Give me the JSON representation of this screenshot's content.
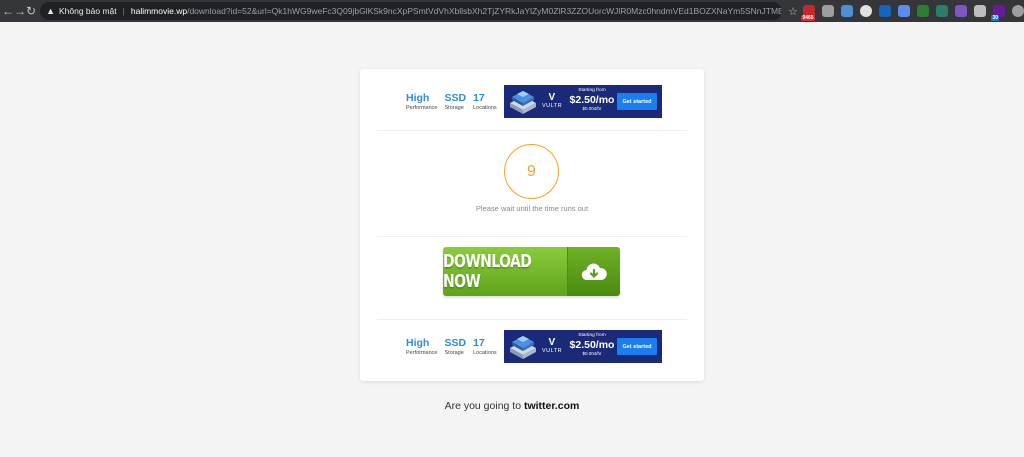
{
  "browser": {
    "security_label": "Không bảo mật",
    "url_host": "halimmovie.wp",
    "url_rest": "/download?id=52&url=Qk1hWG9weFc3Q09jbGlKSk9ncXpPSmtVdVhXbllsbXh2TjZYRkJaYlZyM0ZlR3ZZOUorcWJlR0Mzc0hndmVEd1BOZXNaYm5SNnJTMEJXSVdvdzd1Y3RBR...",
    "extension_badges": [
      "9465",
      "30"
    ]
  },
  "ads": [
    {
      "stats": [
        {
          "big": "High",
          "small": "Performance"
        },
        {
          "big": "SSD",
          "small": "Storage"
        },
        {
          "big": "17",
          "small": "Locations"
        }
      ],
      "brand": "VULTR",
      "starting_from": "Starting from",
      "price": "$2.50/mo",
      "hourly": "$0.004/hr",
      "cta": "Get started"
    },
    {
      "stats": [
        {
          "big": "High",
          "small": "Performance"
        },
        {
          "big": "SSD",
          "small": "Storage"
        },
        {
          "big": "17",
          "small": "Locations"
        }
      ],
      "brand": "VULTR",
      "starting_from": "Starting from",
      "price": "$2.50/mo",
      "hourly": "$0.004/hr",
      "cta": "Get started"
    }
  ],
  "countdown": {
    "value": "9",
    "message": "Please wait until the time runs out"
  },
  "download_button": {
    "label": "DOWNLOAD NOW"
  },
  "footer": {
    "prefix": "Are you going to",
    "destination": "twitter.com"
  }
}
